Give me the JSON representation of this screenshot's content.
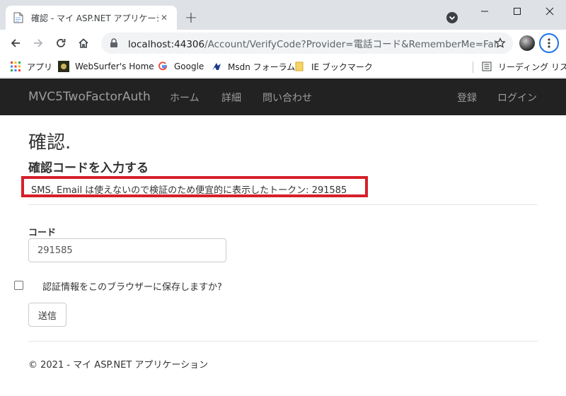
{
  "browser": {
    "tab_title": "確認 - マイ ASP.NET アプリケーション",
    "tab_close": "✕",
    "new_tab": "+",
    "url_host": "localhost:44306",
    "url_path": "/Account/VerifyCode?Provider=電話コード&RememberMe=False&…",
    "bookmarks": [
      {
        "label": "アプリ",
        "icon": "apps-grid-icon"
      },
      {
        "label": "WebSurfer's Home",
        "icon": "websurfer-favicon-icon"
      },
      {
        "label": "Google",
        "icon": "google-icon"
      },
      {
        "label": "Msdn フォーラム",
        "icon": "msdn-icon"
      },
      {
        "label": "IE ブックマーク",
        "icon": "folder-icon"
      }
    ],
    "reading_list": "リーディング リスト"
  },
  "navbar": {
    "brand": "MVC5TwoFactorAuth",
    "links": [
      "ホーム",
      "詳細",
      "問い合わせ"
    ],
    "right_links": [
      "登録",
      "ログイン"
    ]
  },
  "page": {
    "title": "確認.",
    "subtitle": "確認コードを入力する",
    "token_message": "SMS, Email は使えないので検証のため便宜的に表示したトークン: 291585",
    "code_label": "コード",
    "code_value": "291585",
    "remember_label": "認証情報をこのブラウザーに保存しますか?",
    "submit_label": "送信",
    "footer": "© 2021 - マイ ASP.NET アプリケーション"
  },
  "colors": {
    "navbar_bg": "#222222",
    "navbar_text": "#9d9d9d",
    "highlight_border": "#d6202a",
    "chrome_accent": "#1a73e8"
  }
}
